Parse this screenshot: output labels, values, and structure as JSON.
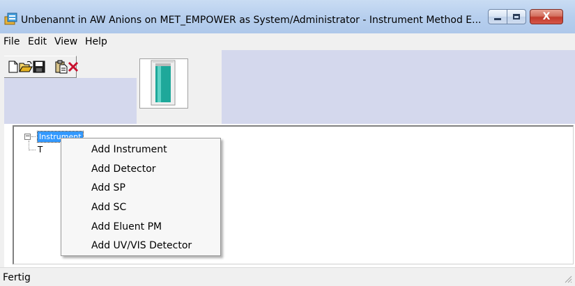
{
  "window": {
    "title": "Unbenannt in AW Anions on MET_EMPOWER as System/Administrator - Instrument Method E...",
    "close_glyph": "X"
  },
  "menubar": {
    "items": [
      {
        "label": "File"
      },
      {
        "label": "Edit"
      },
      {
        "label": "View"
      },
      {
        "label": "Help"
      }
    ]
  },
  "toolbar": {
    "buttons": [
      {
        "icon": "new-document-icon"
      },
      {
        "icon": "open-folder-icon"
      },
      {
        "icon": "save-disk-icon"
      },
      {
        "icon": "paste-icon"
      },
      {
        "icon": "delete-x-icon"
      }
    ],
    "instrument_image": "column-cylinder-icon"
  },
  "tree": {
    "collapse_glyph": "−",
    "root_label": "Instrument",
    "child_label": "T"
  },
  "context_menu": {
    "items": [
      {
        "label": "Add Instrument"
      },
      {
        "label": "Add Detector"
      },
      {
        "label": "Add SP"
      },
      {
        "label": "Add SC"
      },
      {
        "label": "Add Eluent PM"
      },
      {
        "label": "Add UV/VIS Detector"
      }
    ]
  },
  "statusbar": {
    "text": "Fertig"
  },
  "colors": {
    "titlebar": "#b7cfee",
    "toolbar_bg": "#d4d8ed",
    "selection": "#3399ff",
    "column_teal": "#1ea89a",
    "close_red": "#c0392b"
  }
}
